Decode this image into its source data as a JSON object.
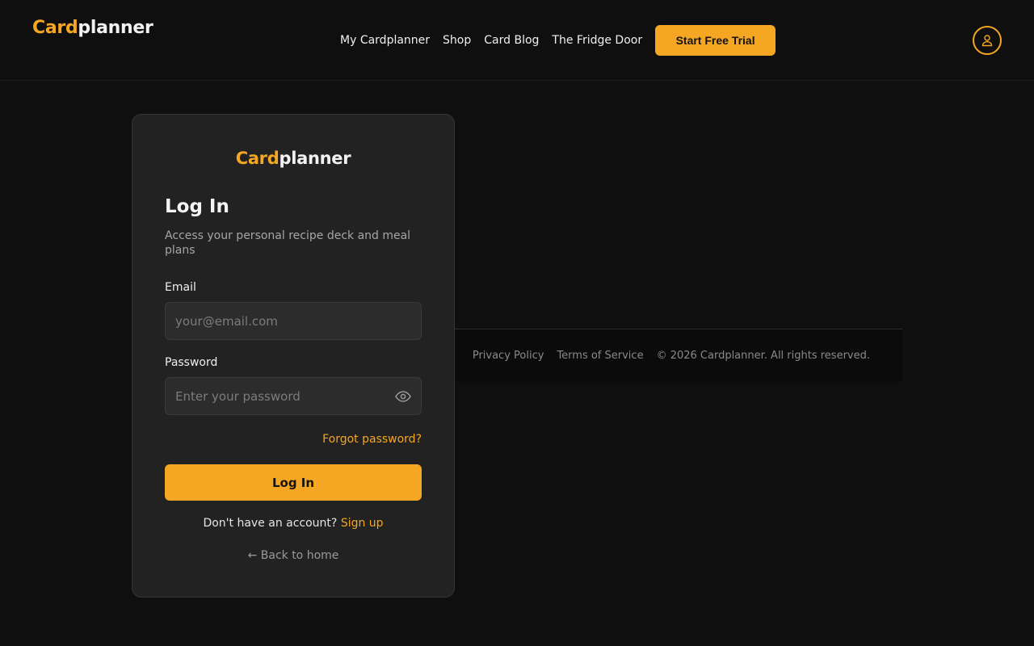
{
  "header": {
    "logo_accent": "Card",
    "logo_rest": "planner",
    "nav": [
      "My Cardplanner",
      "Shop",
      "Card Blog",
      "The Fridge Door"
    ],
    "cta_label": "Start Free Trial",
    "avatar_icon": "user-icon"
  },
  "login": {
    "logo_accent": "Card",
    "logo_rest": "planner",
    "title": "Log In",
    "subtitle": "Access your personal recipe deck and meal plans",
    "email_label": "Email",
    "email_placeholder": "your@email.com",
    "password_label": "Password",
    "password_placeholder": "Enter your password",
    "password_toggle_icon": "eye-icon",
    "forgot_label": "Forgot password?",
    "submit_label": "Log In",
    "signup_prompt": "Don't have an account?",
    "signup_link": "Sign up",
    "back_label": "← Back to home"
  },
  "footer": {
    "links": [
      "Privacy Policy",
      "Terms of Service"
    ],
    "copyright": "© 2026 Cardplanner. All rights reserved."
  },
  "colors": {
    "accent": "#f5a623",
    "background": "#0f0f0f",
    "card": "#222222"
  }
}
